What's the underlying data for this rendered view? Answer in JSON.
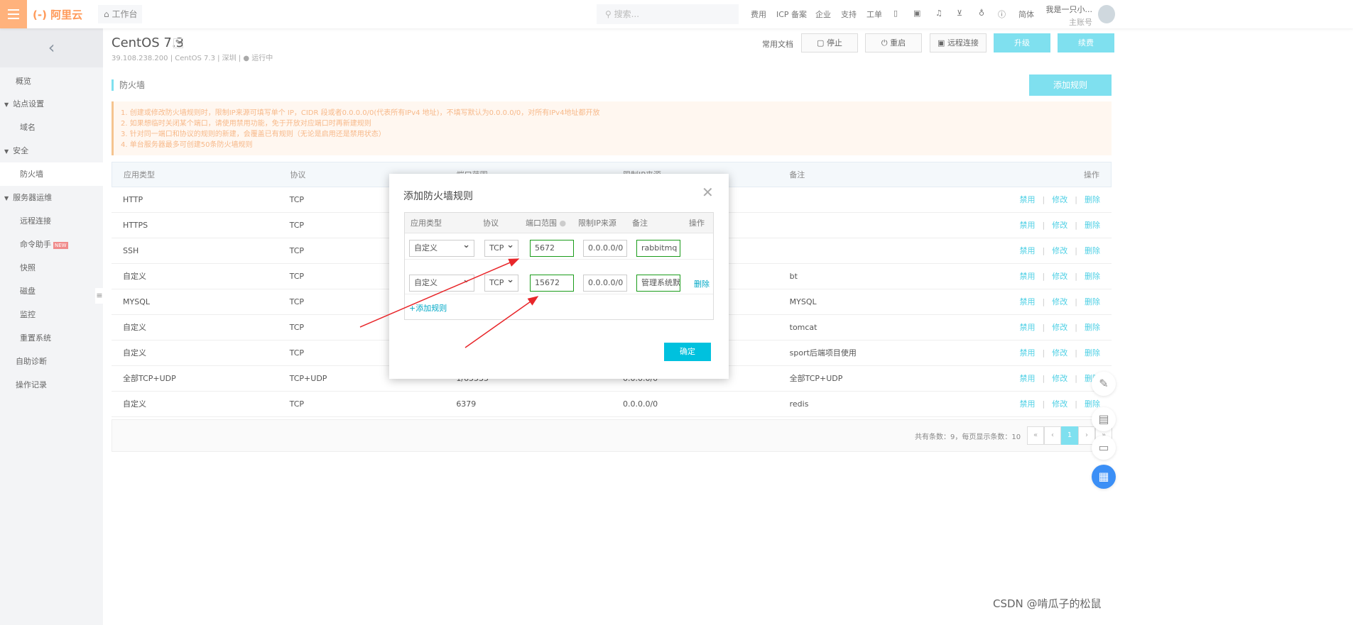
{
  "topbar": {
    "logo": "(-) 阿里云",
    "workbench": "工作台",
    "search_placeholder": "搜索...",
    "nav": [
      "费用",
      "ICP 备案",
      "企业",
      "支持",
      "工单"
    ],
    "lang": "简体",
    "account_name": "我是一只小...",
    "account_role": "主账号"
  },
  "header": {
    "title": "CentOS 7.3",
    "subtitle": "39.108.238.200 | CentOS 7.3 | 深圳 | ● 运行中",
    "docs": "常用文档",
    "stop": "停止",
    "restart": "重启",
    "remote": "远程连接",
    "upgrade": "升级",
    "renew": "续费",
    "status_color": "#52c41a"
  },
  "sidebar": {
    "items": [
      {
        "label": "概览"
      },
      {
        "label": "站点设置",
        "group": true
      },
      {
        "label": "域名"
      },
      {
        "label": "安全",
        "group": true
      },
      {
        "label": "防火墙",
        "active": true
      },
      {
        "label": "服务器运维",
        "group": true
      },
      {
        "label": "远程连接"
      },
      {
        "label": "命令助手",
        "badge": "NEW"
      },
      {
        "label": "快照"
      },
      {
        "label": "磁盘"
      },
      {
        "label": "监控"
      },
      {
        "label": "重置系统"
      },
      {
        "label": "自助诊断"
      },
      {
        "label": "操作记录"
      }
    ]
  },
  "section": {
    "title": "防火墙",
    "add_rule": "添加规则"
  },
  "notice": [
    "1. 创建或修改防火墙规则时，限制IP来源可填写单个 IP，CIDR 段或者0.0.0.0/0(代表所有IPv4 地址)，不填写默认为0.0.0.0/0，对所有IPv4地址都开放",
    "2. 如果想临时关闭某个端口，请使用禁用功能，免于开放对应端口时再新建规则",
    "3. 针对同一端口和协议的规则的新建，会覆盖已有规则（无论是启用还是禁用状态）",
    "4. 单台服务器最多可创建50条防火墙规则"
  ],
  "table": {
    "headers": [
      "应用类型",
      "协议",
      "端口范围",
      "限制IP来源",
      "备注",
      "操作"
    ],
    "rows": [
      [
        "HTTP",
        "TCP",
        "",
        "",
        ""
      ],
      [
        "HTTPS",
        "TCP",
        "",
        "",
        ""
      ],
      [
        "SSH",
        "TCP",
        "",
        "",
        ""
      ],
      [
        "自定义",
        "TCP",
        "",
        "",
        "bt"
      ],
      [
        "MYSQL",
        "TCP",
        "",
        "",
        "MYSQL"
      ],
      [
        "自定义",
        "TCP",
        "",
        "",
        "tomcat"
      ],
      [
        "自定义",
        "TCP",
        "",
        "",
        "sport后端项目使用"
      ],
      [
        "全部TCP+UDP",
        "TCP+UDP",
        "1/65535",
        "0.0.0.0/0",
        "全部TCP+UDP"
      ],
      [
        "自定义",
        "TCP",
        "6379",
        "0.0.0.0/0",
        "redis"
      ]
    ],
    "actions": [
      "禁用",
      "修改",
      "删除"
    ],
    "footer": "共有条数：9，每页显示条数：10",
    "pages": [
      "«",
      "‹",
      "1",
      "›",
      "»"
    ],
    "current_page": 1
  },
  "modal": {
    "title": "添加防火墙规则",
    "headers": [
      "应用类型",
      "协议",
      "端口范围",
      "限制IP来源",
      "备注",
      "操作"
    ],
    "rows": [
      {
        "type": "自定义",
        "protocol": "TCP",
        "port": "5672",
        "ip": "0.0.0.0/0",
        "note": "rabbitmq",
        "action": ""
      },
      {
        "type": "自定义",
        "protocol": "TCP",
        "port": "15672",
        "ip": "0.0.0.0/0",
        "note": "管理系统默",
        "action": "删除"
      }
    ],
    "add": "+添加规则",
    "confirm": "确定",
    "accent": "#00c1de"
  },
  "watermark": "CSDN @啃瓜子的松鼠"
}
